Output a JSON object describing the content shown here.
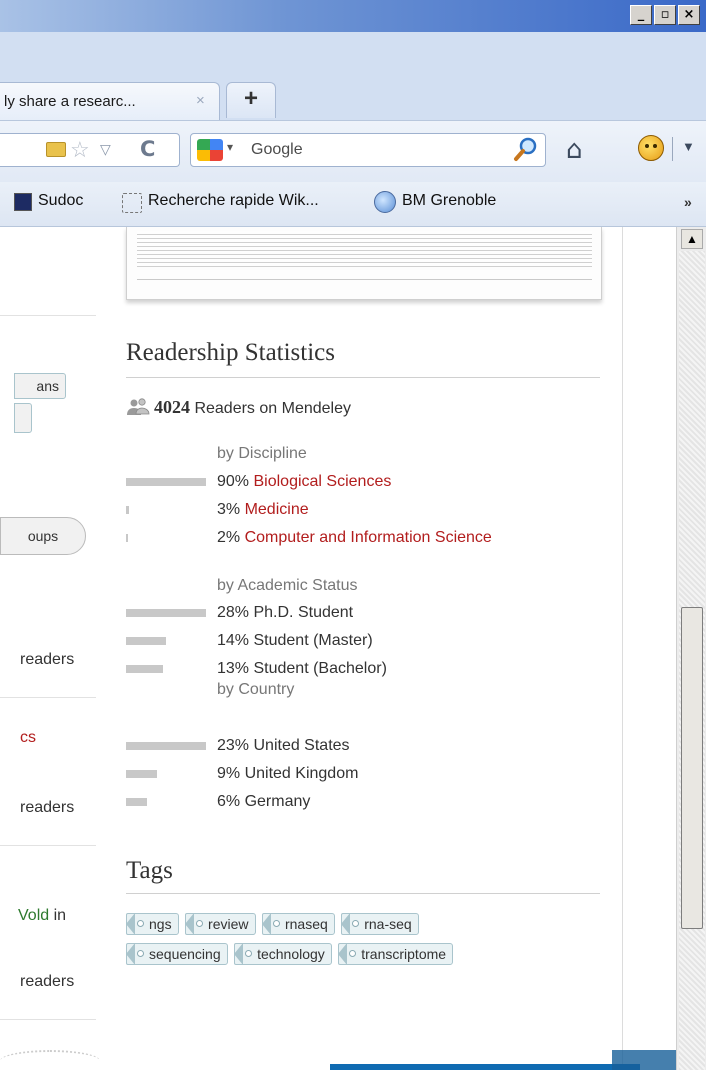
{
  "window": {
    "min": "_",
    "max": "▫",
    "close": "×"
  },
  "tab": {
    "title": "ly share a researc...",
    "close": "×",
    "new_tab": "+"
  },
  "nav": {
    "search_placeholder": "Google"
  },
  "bookmarks": {
    "items": [
      "Sudoc",
      "Recherche rapide Wik...",
      "BM Grenoble"
    ],
    "more": "»"
  },
  "left": {
    "btn1": "ans",
    "btn2": "",
    "groups_btn": "oups",
    "r1": "readers",
    "link1": "cs",
    "r2": "readers",
    "frag": "Vold",
    "frag_in": " in",
    "r3": "readers"
  },
  "readership": {
    "title": "Readership Statistics",
    "count": "4024",
    "count_label": " Readers on Mendeley",
    "discipline": {
      "label": "by Discipline",
      "items": [
        {
          "pct": "90%",
          "name": "Biological Sciences",
          "value": 90
        },
        {
          "pct": "3%",
          "name": "Medicine",
          "value": 3
        },
        {
          "pct": "2%",
          "name": "Computer and Information Science",
          "value": 2
        }
      ]
    },
    "academic": {
      "label": "by Academic Status",
      "items": [
        {
          "pct": "28%",
          "name": "Ph.D. Student",
          "value": 28
        },
        {
          "pct": "14%",
          "name": "Student (Master)",
          "value": 14
        },
        {
          "pct": "13%",
          "name": "Student (Bachelor)",
          "value": 13
        }
      ]
    },
    "country": {
      "label": "by Country",
      "items": [
        {
          "pct": "23%",
          "name": "United States",
          "value": 23
        },
        {
          "pct": "9%",
          "name": "United Kingdom",
          "value": 9
        },
        {
          "pct": "6%",
          "name": "Germany",
          "value": 6
        }
      ]
    }
  },
  "tags": {
    "title": "Tags",
    "items": [
      "ngs",
      "review",
      "rnaseq",
      "rna-seq",
      "sequencing",
      "technology",
      "transcriptome"
    ]
  },
  "colors": {
    "link_red": "#b21d1d",
    "bar_grey": "#c8c8c8",
    "tag_bg": "#e9f2f4"
  }
}
